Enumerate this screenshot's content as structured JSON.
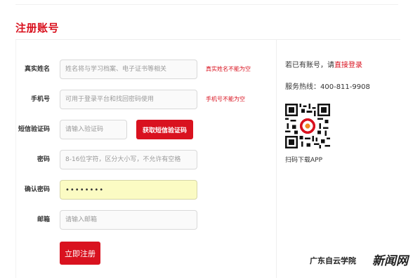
{
  "page": {
    "title": "注册账号"
  },
  "form": {
    "realname": {
      "label": "真实姓名",
      "placeholder": "姓名将与学习档案、电子证书等相关",
      "error": "真实姓名不能为空"
    },
    "phone": {
      "label": "手机号",
      "placeholder": "可用于登录平台和找回密码使用",
      "error": "手机号不能为空"
    },
    "sms_code": {
      "label": "短信验证码",
      "placeholder": "请输入验证码",
      "button_label": "获取短信验证码"
    },
    "password": {
      "label": "密码",
      "placeholder": "8-16位字符，区分大小写，不允许有空格"
    },
    "confirm_password": {
      "label": "确认密码",
      "value": "••••••••"
    },
    "email": {
      "label": "邮箱",
      "placeholder": "请输入邮箱"
    },
    "submit_label": "立即注册"
  },
  "aside": {
    "has_account_text": "若已有账号，请",
    "login_link": "直接登录",
    "hotline": "服务热线：400-811-9908",
    "qr_caption": "扫码下载APP"
  },
  "watermark": {
    "left": "广东自云学院",
    "right": "新闻网"
  },
  "colors": {
    "accent": "#d9121f",
    "input_bg": "#fafafa",
    "autofill_bg": "#fbfbc3"
  }
}
